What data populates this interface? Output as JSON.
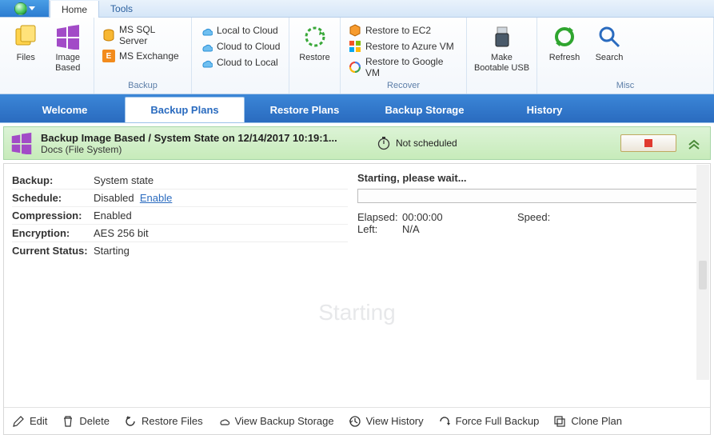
{
  "menubar": {
    "tabs": [
      "Home",
      "Tools"
    ],
    "active": 0
  },
  "ribbon": {
    "groups": [
      {
        "caption": "",
        "big": [
          {
            "label": "Files"
          },
          {
            "label": "Image\nBased"
          }
        ]
      },
      {
        "caption": "Backup",
        "mini": [
          {
            "label": "MS SQL Server"
          },
          {
            "label": "MS Exchange"
          }
        ]
      },
      {
        "caption": "",
        "mini": [
          {
            "label": "Local to Cloud"
          },
          {
            "label": "Cloud to Cloud"
          },
          {
            "label": "Cloud to Local"
          }
        ]
      },
      {
        "caption": "",
        "big": [
          {
            "label": "Restore"
          }
        ]
      },
      {
        "caption": "Recover",
        "mini": [
          {
            "label": "Restore to EC2"
          },
          {
            "label": "Restore to Azure VM"
          },
          {
            "label": "Restore to Google VM"
          }
        ]
      },
      {
        "caption": "",
        "big": [
          {
            "label": "Make\nBootable USB"
          }
        ]
      },
      {
        "caption": "Misc",
        "big": [
          {
            "label": "Refresh"
          },
          {
            "label": "Search"
          }
        ]
      }
    ]
  },
  "maintabs": {
    "items": [
      "Welcome",
      "Backup Plans",
      "Restore Plans",
      "Backup Storage",
      "History"
    ],
    "active": 1
  },
  "plan": {
    "title": "Backup Image Based / System State on 12/14/2017 10:19:1...",
    "subtitle": "Docs (File System)",
    "schedule_status": "Not scheduled"
  },
  "details": {
    "rows": [
      {
        "k": "Backup:",
        "v": "System state"
      },
      {
        "k": "Schedule:",
        "v": "Disabled",
        "link": "Enable"
      },
      {
        "k": "Compression:",
        "v": "Enabled"
      },
      {
        "k": "Encryption:",
        "v": "AES 256 bit"
      },
      {
        "k": "Current Status:",
        "v": "Starting"
      }
    ]
  },
  "progress": {
    "header": "Starting, please wait...",
    "elapsed_label": "Elapsed:",
    "elapsed": "00:00:00",
    "left_label": "Left:",
    "left": "N/A",
    "speed_label": "Speed:",
    "speed": ""
  },
  "big_status": "Starting",
  "actions": [
    "Edit",
    "Delete",
    "Restore Files",
    "View Backup Storage",
    "View History",
    "Force Full Backup",
    "Clone Plan"
  ]
}
